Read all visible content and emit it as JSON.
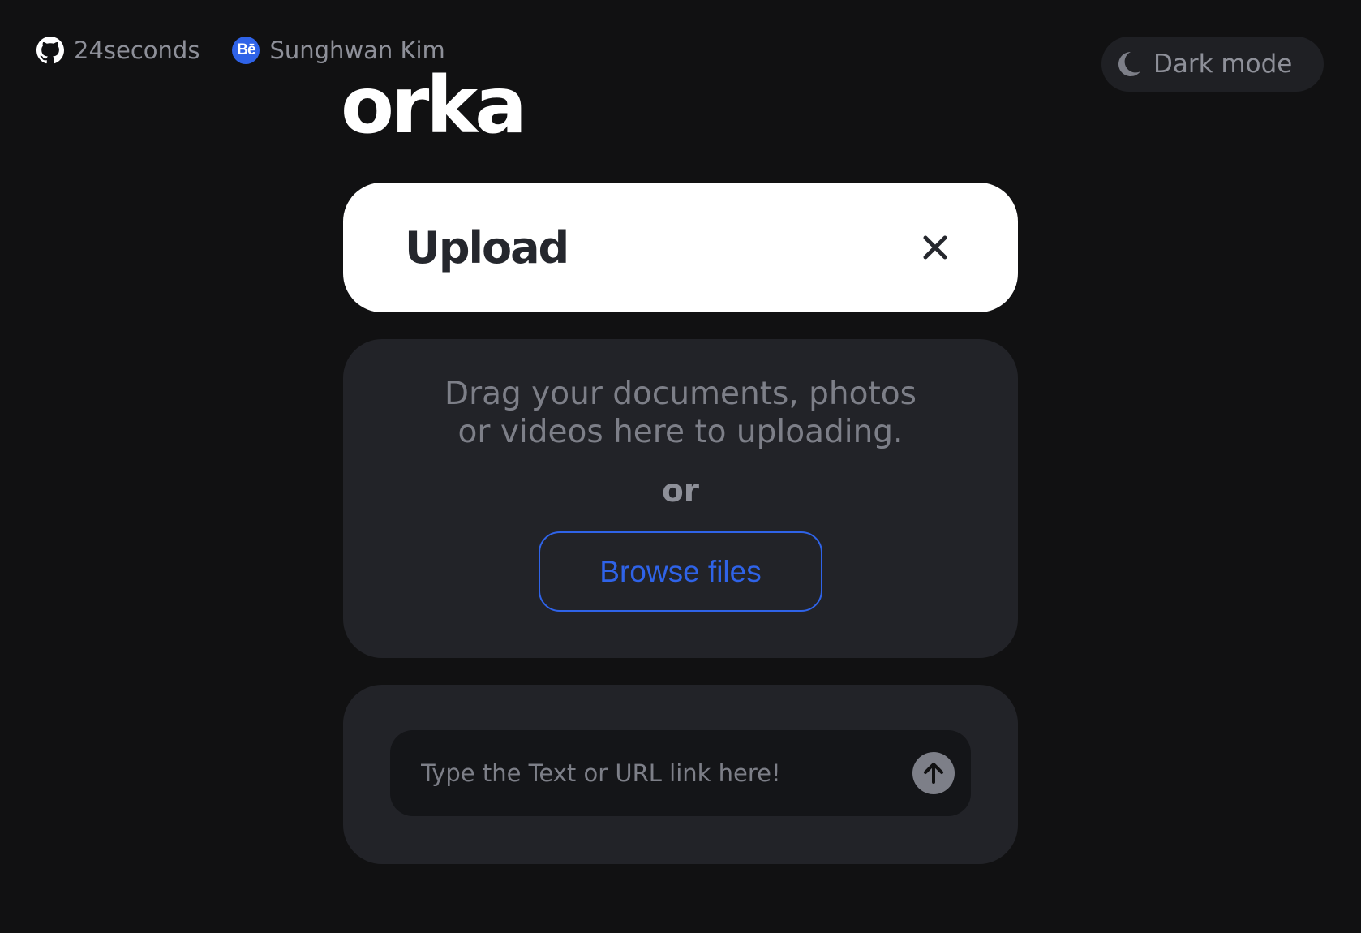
{
  "header": {
    "github_label": "24seconds",
    "behance_label": "Sunghwan Kim",
    "behance_icon_text": "Bē",
    "dark_mode_label": "Dark mode"
  },
  "logo": {
    "text": "orka"
  },
  "upload": {
    "title": "Upload"
  },
  "drop_zone": {
    "line1": "Drag your documents, photos",
    "line2": "or videos here to uploading.",
    "or_label": "or",
    "browse_label": "Browse files"
  },
  "text_input": {
    "value": "",
    "placeholder": "Type the Text or URL link here!"
  },
  "colors": {
    "background": "#111112",
    "card": "#222328",
    "accent_blue": "#2f63e8",
    "muted_text": "#7d7f88"
  },
  "icons": {
    "github": "github-icon",
    "behance": "behance-icon",
    "moon": "moon-icon",
    "close": "close-icon",
    "send": "arrow-up-icon"
  }
}
